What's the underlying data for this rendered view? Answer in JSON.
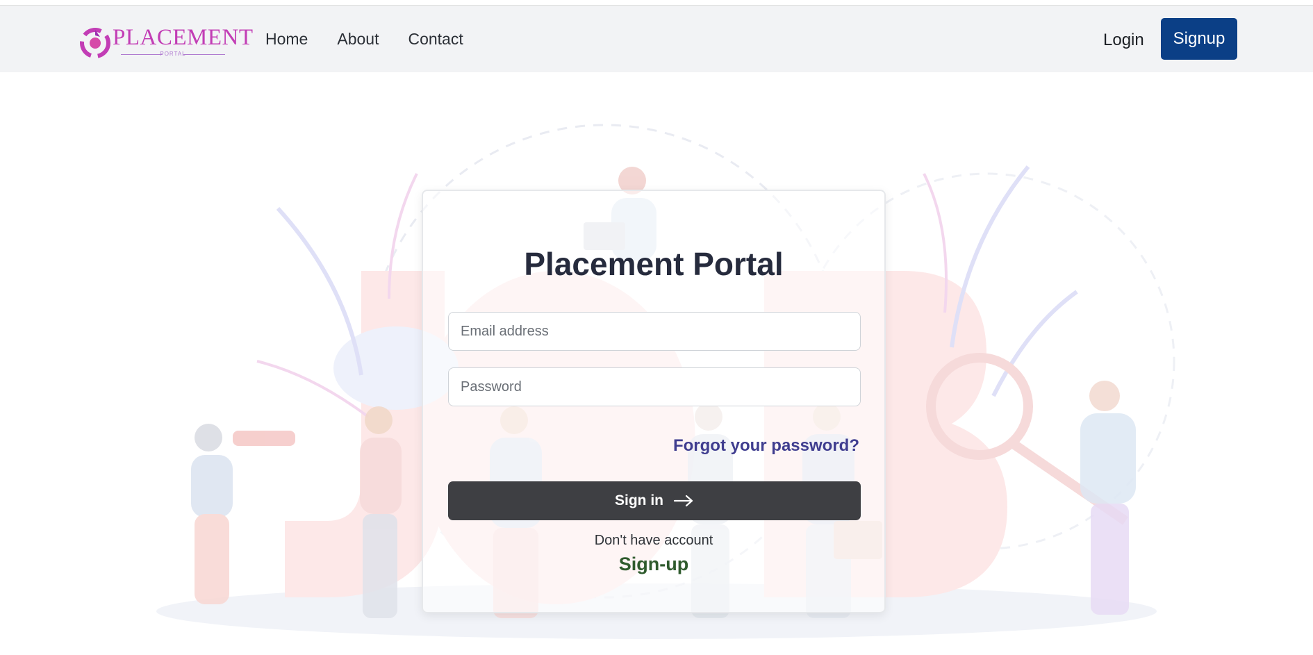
{
  "brand": {
    "name": "PLACEMENT",
    "sub": "PORTAL",
    "icon": "placement-logo-icon",
    "color": "#c23db5"
  },
  "nav": {
    "links": [
      "Home",
      "About",
      "Contact"
    ],
    "login_label": "Login",
    "signup_label": "Signup"
  },
  "colors": {
    "navbar_bg": "#f2f3f5",
    "signup_bg": "#0b3f86",
    "signin_bg": "#3e3f43",
    "forgot": "#3f3d8f",
    "signup_link": "#2f5b2d"
  },
  "login_card": {
    "title": "Placement Portal",
    "email_placeholder": "Email address",
    "password_placeholder": "Password",
    "forgot_label": "Forgot your password?",
    "signin_label": "Sign in",
    "signin_icon": "arrow-right-icon",
    "no_account_text": "Don't have account",
    "signup_link_label": "Sign-up"
  },
  "background": {
    "illustration": "job-search-people-illustration"
  }
}
